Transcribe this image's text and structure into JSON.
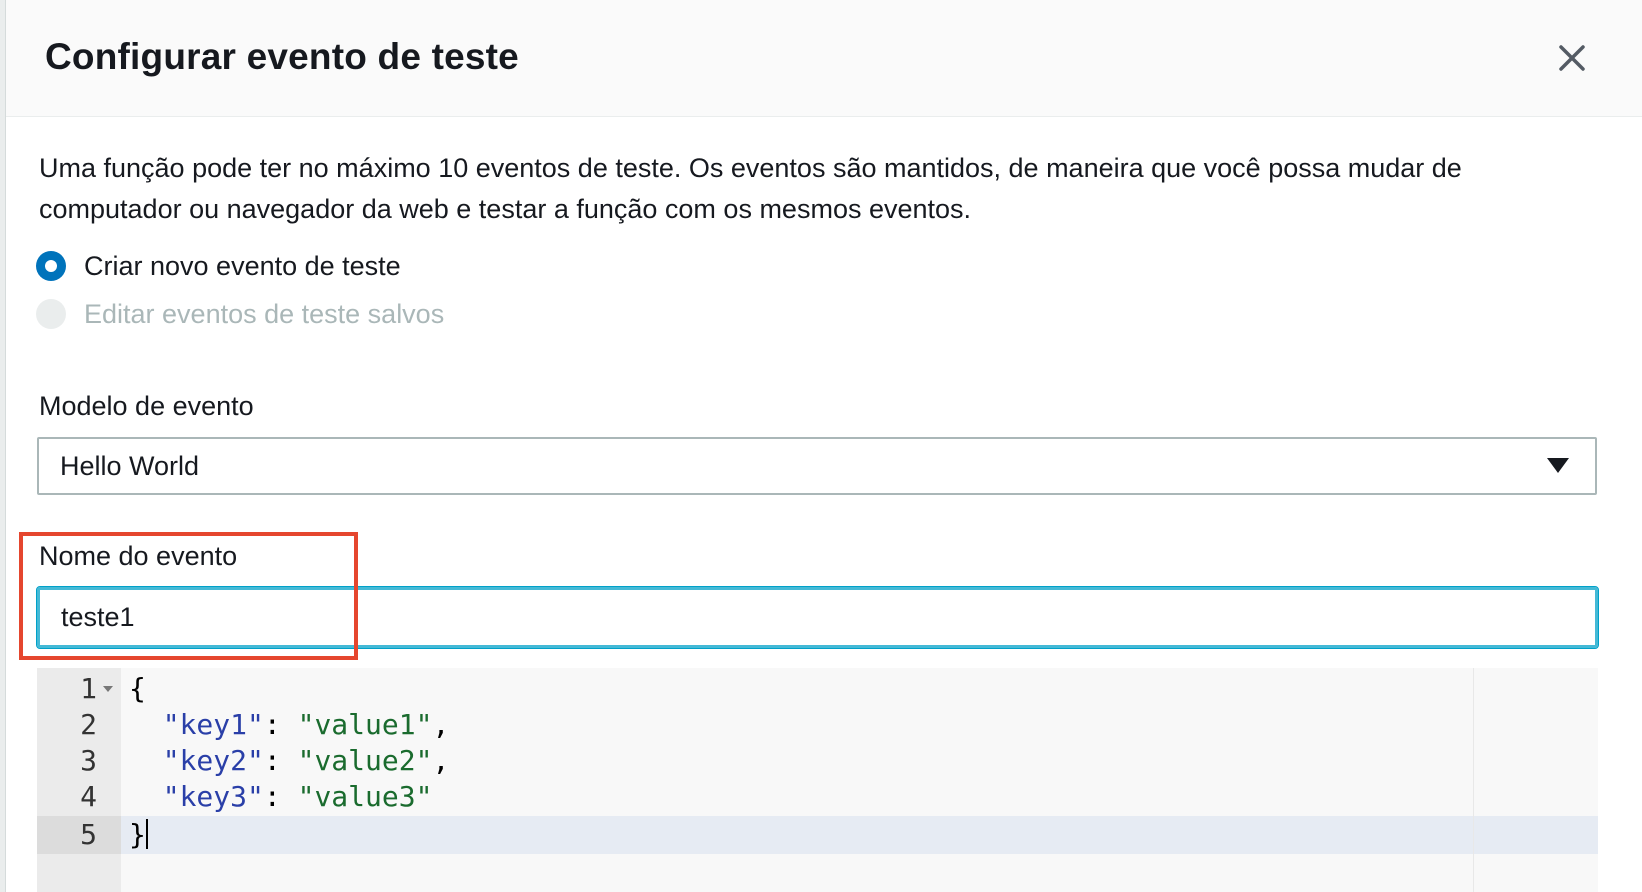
{
  "dialog": {
    "title": "Configurar evento de teste",
    "close_label": "×",
    "description": "Uma função pode ter no máximo 10 eventos de teste. Os eventos são mantidos, de maneira que você possa mudar de computador ou navegador da web e testar a função com os mesmos eventos."
  },
  "options": {
    "create_new": {
      "label": "Criar novo evento de teste",
      "selected": true
    },
    "edit_saved": {
      "label": "Editar eventos de teste salvos",
      "selected": false,
      "disabled": true
    }
  },
  "template_field": {
    "label": "Modelo de evento",
    "value": "Hello World"
  },
  "name_field": {
    "label": "Nome do evento",
    "value": "teste1"
  },
  "editor": {
    "line_numbers": [
      "1",
      "2",
      "3",
      "4",
      "5"
    ],
    "lines": [
      {
        "parts": [
          {
            "t": "punct",
            "v": "{"
          }
        ]
      },
      {
        "parts": [
          {
            "t": "punct",
            "v": "  "
          },
          {
            "t": "key",
            "v": "\"key1\""
          },
          {
            "t": "punct",
            "v": ": "
          },
          {
            "t": "str",
            "v": "\"value1\""
          },
          {
            "t": "punct",
            "v": ","
          }
        ]
      },
      {
        "parts": [
          {
            "t": "punct",
            "v": "  "
          },
          {
            "t": "key",
            "v": "\"key2\""
          },
          {
            "t": "punct",
            "v": ": "
          },
          {
            "t": "str",
            "v": "\"value2\""
          },
          {
            "t": "punct",
            "v": ","
          }
        ]
      },
      {
        "parts": [
          {
            "t": "punct",
            "v": "  "
          },
          {
            "t": "key",
            "v": "\"key3\""
          },
          {
            "t": "punct",
            "v": ": "
          },
          {
            "t": "str",
            "v": "\"value3\""
          }
        ]
      },
      {
        "parts": [
          {
            "t": "punct",
            "v": "}"
          }
        ]
      }
    ],
    "active_line": 5
  },
  "colors": {
    "accent": "#0073bb",
    "focus_border": "#44b9d6",
    "highlight_annotation": "#e5462e"
  }
}
